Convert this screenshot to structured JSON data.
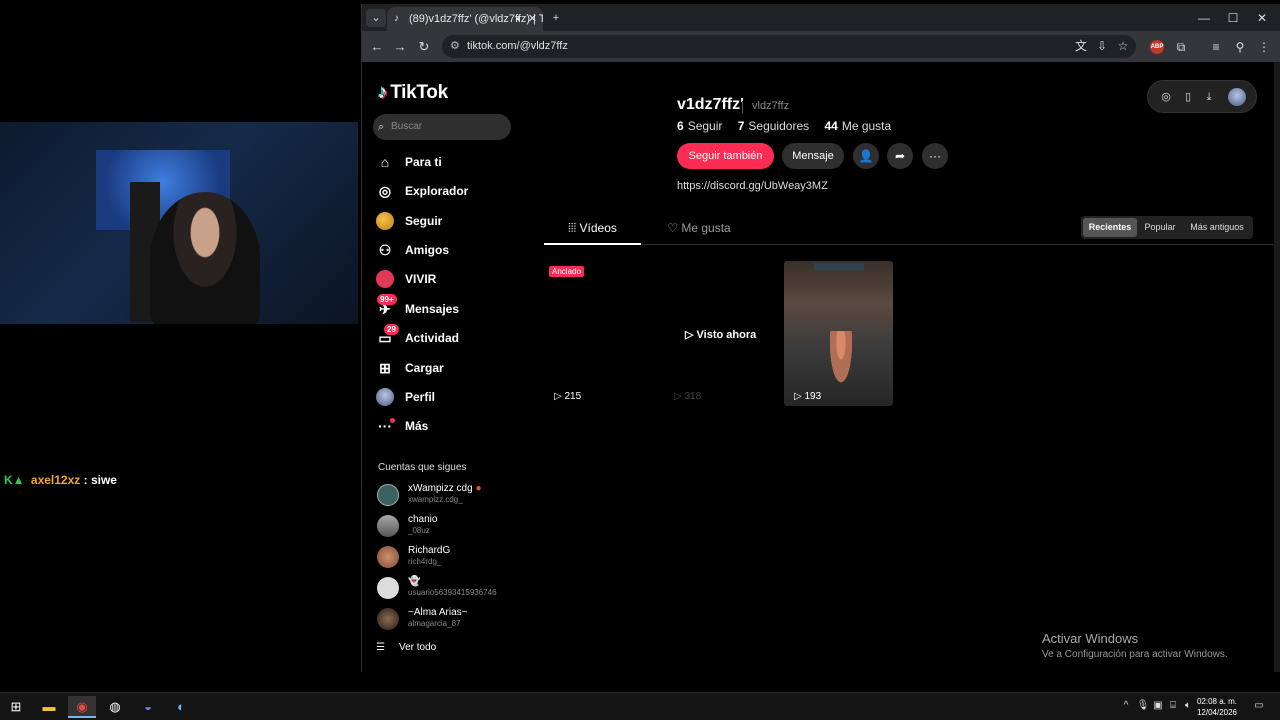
{
  "chat": {
    "user": "axel12xz",
    "separator": ":",
    "message": "siwe"
  },
  "browser": {
    "tab_title": "(89)v1dz7ffz' (@vldz7ffz) | T",
    "url": "tiktok.com/@vldz7ffz"
  },
  "tiktok": {
    "brand": "TikTok",
    "search_placeholder": "Buscar",
    "nav": [
      {
        "label": "Para ti",
        "icon": "home-icon"
      },
      {
        "label": "Explorador",
        "icon": "compass-icon"
      },
      {
        "label": "Seguir",
        "icon": "following-avatar-icon"
      },
      {
        "label": "Amigos",
        "icon": "friends-icon"
      },
      {
        "label": "VIVIR",
        "icon": "live-icon"
      },
      {
        "label": "Mensajes",
        "icon": "messages-icon",
        "badge": "99+"
      },
      {
        "label": "Actividad",
        "icon": "activity-icon",
        "badge": "29"
      },
      {
        "label": "Cargar",
        "icon": "upload-icon"
      },
      {
        "label": "Perfil",
        "icon": "profile-avatar-icon"
      },
      {
        "label": "Más",
        "icon": "more-icon"
      }
    ],
    "following_title": "Cuentas que sigues",
    "accounts": [
      {
        "name": "xWampizz cdg",
        "handle": "xwampizz.cdg_",
        "color": "#3a6060"
      },
      {
        "name": "chanio",
        "handle": "_08uz",
        "color": "#888888"
      },
      {
        "name": "RichardG",
        "handle": "rich4rdg_",
        "color": "#b07a5a"
      },
      {
        "name": "",
        "handle": "usuario56393415936746",
        "color": "#dddddd"
      },
      {
        "name": "~Alma Arias~",
        "handle": "almagarcia_87",
        "color": "#6a5040"
      }
    ],
    "see_all": "Ver todo"
  },
  "profile": {
    "display_name": "v1dz7ffz'",
    "handle": "vldz7ffz",
    "following_count": "6",
    "following_label": "Seguir",
    "followers_count": "7",
    "followers_label": "Seguidores",
    "likes_count": "44",
    "likes_label": "Me gusta",
    "follow_back_label": "Seguir también",
    "message_label": "Mensaje",
    "bio_link": "https://discord.gg/UbWeay3MZ"
  },
  "tabs": {
    "videos": "Vídeos",
    "likes": "Me gusta"
  },
  "sort": {
    "recent": "Recientes",
    "popular": "Popular",
    "oldest": "Más antiguos"
  },
  "videos": [
    {
      "views": "215",
      "pinned_label": "Anclado"
    },
    {
      "views": "318",
      "overlay": "Visto ahora"
    },
    {
      "views": "193"
    }
  ],
  "windows": {
    "activate_title": "Activar Windows",
    "activate_sub": "Ve a Configuración para activar Windows."
  },
  "clock": {
    "time": "02:08 a. m.",
    "date": "12/04/2026"
  }
}
